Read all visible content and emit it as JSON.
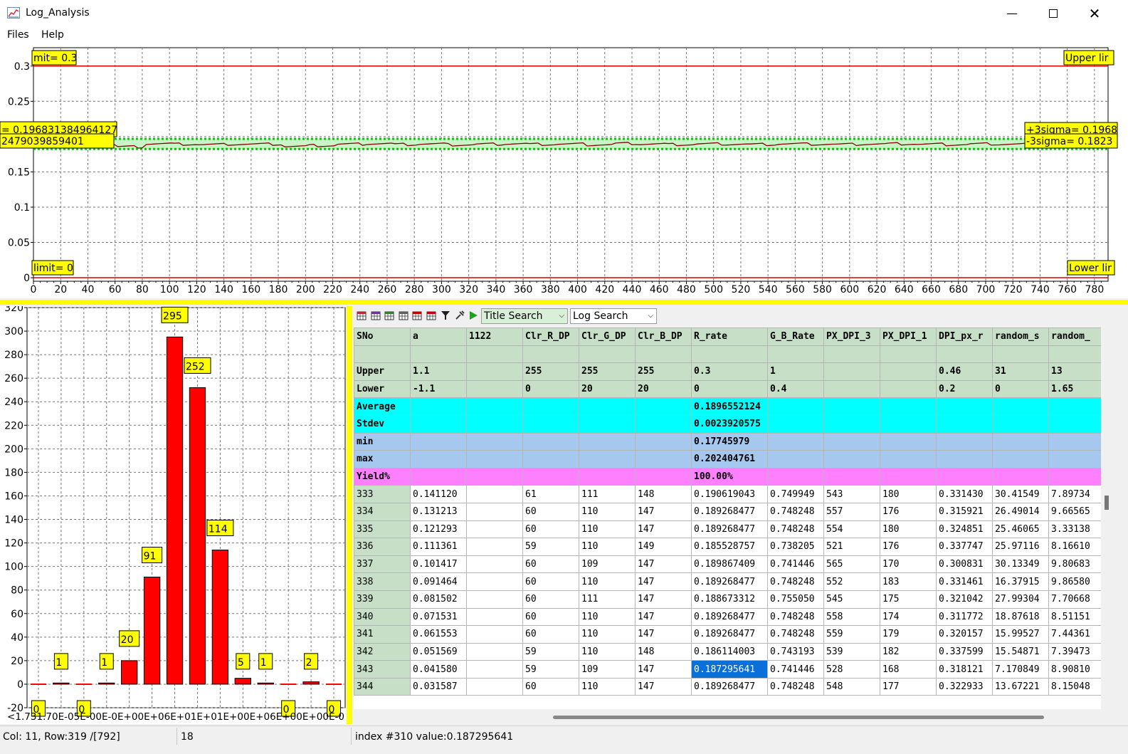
{
  "window": {
    "title": "Log_Analysis"
  },
  "menu": {
    "files": "Files",
    "help": "Help"
  },
  "trend_chart": {
    "y_ticks": [
      "0.3",
      "0.25",
      "0.2",
      "0.15",
      "0.1",
      "0.05",
      "0"
    ],
    "x_ticks": [
      "0",
      "20",
      "40",
      "60",
      "80",
      "100",
      "120",
      "140",
      "160",
      "180",
      "200",
      "220",
      "240",
      "260",
      "280",
      "300",
      "320",
      "340",
      "360",
      "380",
      "400",
      "420",
      "440",
      "460",
      "480",
      "500",
      "520",
      "540",
      "560",
      "580",
      "600",
      "620",
      "640",
      "660",
      "680",
      "700",
      "720",
      "740",
      "760",
      "780"
    ],
    "labels": {
      "upper_left": "mit= 0.3",
      "upper_right": "Upper lir",
      "plus_sigma_left": "= 0.196831384964127",
      "minus_sigma_left": "2479039859401",
      "plus_sigma_right": "+3sigma= 0.1968",
      "minus_sigma_right": "-3sigma= 0.1823",
      "lower_left": "limit= 0",
      "lower_right": "Lower lir"
    }
  },
  "histogram": {
    "y_ticks": [
      "320",
      "300",
      "280",
      "260",
      "240",
      "220",
      "200",
      "180",
      "160",
      "140",
      "120",
      "100",
      "80",
      "60",
      "40",
      "20",
      "0",
      "-20"
    ],
    "x_tick_text": "<1.731.70E-05E-00E-0E+00E+06E+01E+01E+00E+06E+00E+00E-0",
    "bar_labels": [
      "0",
      "1",
      "0",
      "1",
      "20",
      "91",
      "295",
      "252",
      "114",
      "5",
      "1",
      "0",
      "2",
      "0"
    ]
  },
  "chart_data": [
    {
      "type": "line",
      "title": "",
      "xlabel": "",
      "ylabel": "",
      "xlim": [
        0,
        790
      ],
      "ylim": [
        0,
        0.3
      ],
      "grid": true,
      "series": [
        {
          "name": "",
          "values": [
            0.1906,
            0.1893,
            0.1893,
            0.1855,
            0.1899,
            0.1893,
            0.1887,
            0.1893,
            0.1893,
            0.1861,
            0.1873,
            0.1893,
            0.1901,
            0.1889,
            0.1896,
            0.1884,
            0.1893,
            0.1899,
            0.1891,
            0.1894,
            0.1885,
            0.1902,
            0.1895,
            0.1888,
            0.1896,
            0.1893,
            0.1889,
            0.1897,
            0.1893,
            0.189,
            0.1895,
            0.1898,
            0.1892,
            0.1887,
            0.1896,
            0.1893,
            0.1894,
            0.1891,
            0.1896,
            0.1893
          ]
        },
        {
          "name": "",
          "values": [
            0.3,
            0.3
          ]
        },
        {
          "name": "",
          "values": [
            0,
            0
          ]
        },
        {
          "name": "",
          "values": [
            0.1968,
            0.1968
          ]
        },
        {
          "name": "",
          "values": [
            0.1825,
            0.1825
          ]
        }
      ]
    },
    {
      "type": "bar",
      "title": "",
      "xlabel": "",
      "ylabel": "",
      "ylim": [
        -20,
        320
      ],
      "grid": true,
      "values": [
        0,
        1,
        0,
        1,
        20,
        91,
        295,
        252,
        114,
        5,
        1,
        0,
        2,
        0
      ]
    }
  ],
  "toolbar": {
    "title_search": "Title Search",
    "log_search": "Log  Search",
    "icons": [
      "table-add-icon",
      "table-export-icon",
      "table-import-icon",
      "table-merge-icon",
      "table-lock-icon",
      "table-lock-red-icon",
      "filter-icon",
      "tools-icon",
      "run-icon"
    ]
  },
  "grid": {
    "headers": [
      "SNo",
      "a",
      "1122",
      "Clr_R_DP",
      "Clr_G_DP",
      "Clr_B_DP",
      "R_rate",
      "G_B_Rate",
      "PX_DPI_3",
      "PX_DPI_1",
      "DPI_px_r",
      "random_s",
      "random_"
    ],
    "limits": [
      [
        "Upper",
        "1.1",
        "",
        "255",
        "255",
        "255",
        "0.3",
        "1",
        "",
        "",
        "0.46",
        "31",
        "13"
      ],
      [
        "Lower",
        "-1.1",
        "",
        "0",
        "20",
        "20",
        "0",
        "0.4",
        "",
        "",
        "0.2",
        "0",
        "1.65"
      ]
    ],
    "stats": [
      [
        "Average",
        "",
        "",
        "",
        "",
        "",
        "0.1896552124",
        "",
        "",
        "",
        "",
        "",
        ""
      ],
      [
        "Stdev",
        "",
        "",
        "",
        "",
        "",
        "0.0023920575",
        "",
        "",
        "",
        "",
        "",
        ""
      ],
      [
        "min",
        "",
        "",
        "",
        "",
        "",
        "0.17745979",
        "",
        "",
        "",
        "",
        "",
        ""
      ],
      [
        "max",
        "",
        "",
        "",
        "",
        "",
        "0.202404761",
        "",
        "",
        "",
        "",
        "",
        ""
      ],
      [
        "Yield%",
        "",
        "",
        "",
        "",
        "",
        "100.00%",
        "",
        "",
        "",
        "",
        "",
        ""
      ]
    ],
    "rows": [
      [
        "333",
        "0.141120",
        "",
        "61",
        "111",
        "148",
        "0.190619043",
        "0.749949",
        "543",
        "180",
        "0.331430",
        "30.41549",
        "7.89734"
      ],
      [
        "334",
        "0.131213",
        "",
        "60",
        "110",
        "147",
        "0.189268477",
        "0.748248",
        "557",
        "176",
        "0.315921",
        "26.49014",
        "9.66565"
      ],
      [
        "335",
        "0.121293",
        "",
        "60",
        "110",
        "147",
        "0.189268477",
        "0.748248",
        "554",
        "180",
        "0.324851",
        "25.46065",
        "3.33138"
      ],
      [
        "336",
        "0.111361",
        "",
        "59",
        "110",
        "149",
        "0.185528757",
        "0.738205",
        "521",
        "176",
        "0.337747",
        "25.97116",
        "8.16610"
      ],
      [
        "337",
        "0.101417",
        "",
        "60",
        "109",
        "147",
        "0.189867409",
        "0.741446",
        "565",
        "170",
        "0.300831",
        "30.13349",
        "9.80683"
      ],
      [
        "338",
        "0.091464",
        "",
        "60",
        "110",
        "147",
        "0.189268477",
        "0.748248",
        "552",
        "183",
        "0.331461",
        "16.37915",
        "9.86580"
      ],
      [
        "339",
        "0.081502",
        "",
        "60",
        "111",
        "147",
        "0.188673312",
        "0.755050",
        "545",
        "175",
        "0.321042",
        "27.99304",
        "7.70668"
      ],
      [
        "340",
        "0.071531",
        "",
        "60",
        "110",
        "147",
        "0.189268477",
        "0.748248",
        "558",
        "174",
        "0.311772",
        "18.87618",
        "8.51151"
      ],
      [
        "341",
        "0.061553",
        "",
        "60",
        "110",
        "147",
        "0.189268477",
        "0.748248",
        "559",
        "179",
        "0.320157",
        "15.99527",
        "7.44361"
      ],
      [
        "342",
        "0.051569",
        "",
        "59",
        "110",
        "148",
        "0.186114003",
        "0.743193",
        "539",
        "182",
        "0.337599",
        "15.54871",
        "7.39473"
      ],
      [
        "343",
        "0.041580",
        "",
        "59",
        "109",
        "147",
        "0.187295641",
        "0.741446",
        "528",
        "168",
        "0.318121",
        "7.170849",
        "8.90810"
      ],
      [
        "344",
        "0.031587",
        "",
        "60",
        "110",
        "147",
        "0.189268477",
        "0.748248",
        "548",
        "177",
        "0.322933",
        "13.67221",
        "8.15048"
      ]
    ]
  },
  "status": {
    "position": "Col: 11, Row:319 /[792]",
    "count": "18",
    "info": "index #310 value:0.187295641"
  }
}
